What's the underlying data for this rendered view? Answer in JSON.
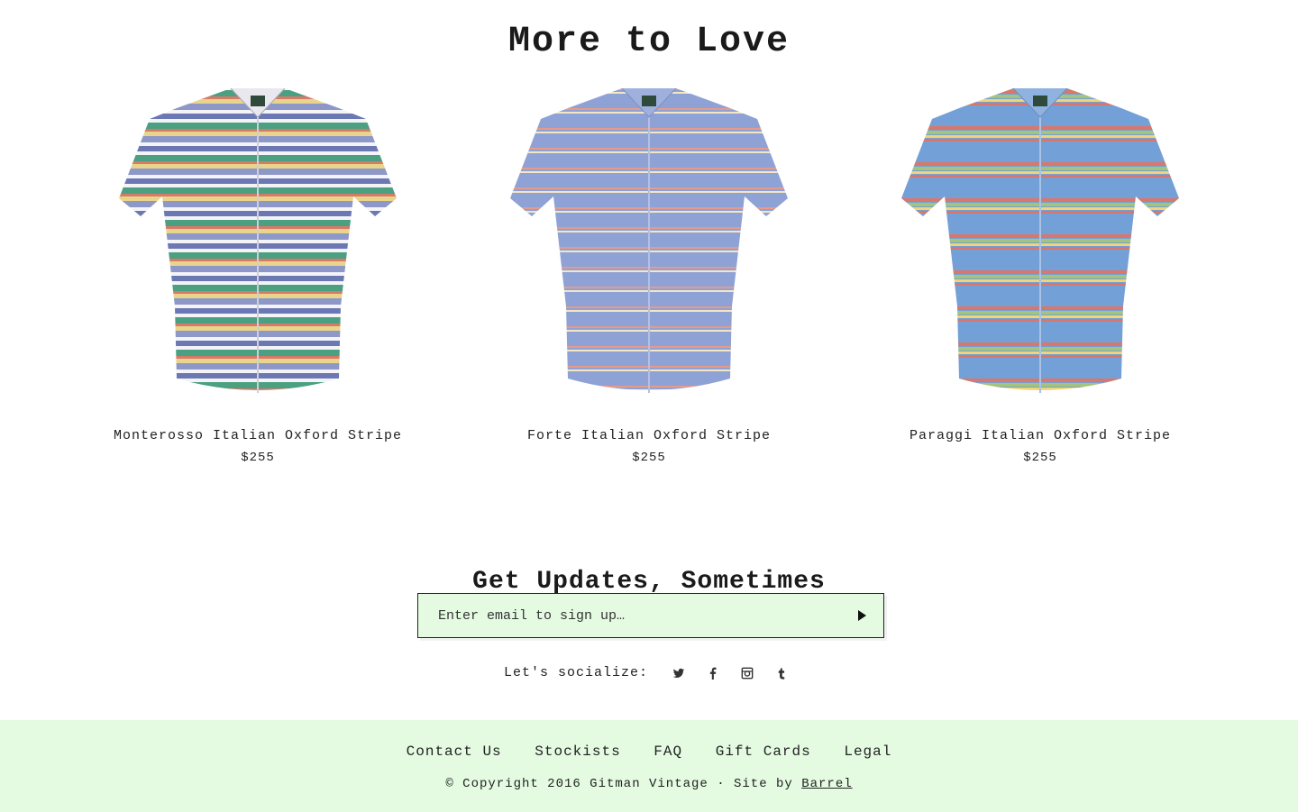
{
  "more_to_love": {
    "title": "More to Love",
    "products": [
      {
        "name": "Monterosso Italian Oxford Stripe",
        "price": "$255",
        "image": "short-sleeve-shirt-multicolor-stripe",
        "stripe_colors": [
          "#6c78b4",
          "#f4f4f6",
          "#4aa080",
          "#d97a68",
          "#e8d48a",
          "#8d97c8"
        ]
      },
      {
        "name": "Forte Italian Oxford Stripe",
        "price": "$255",
        "image": "short-sleeve-shirt-blue-stripe",
        "stripe_colors": [
          "#8fa2d6",
          "#e69a8a",
          "#f2e6c4",
          "#8fa2d6"
        ]
      },
      {
        "name": "Paraggi Italian Oxford Stripe",
        "price": "$255",
        "image": "short-sleeve-shirt-blue-multistripe",
        "stripe_colors": [
          "#73a0d6",
          "#d9776d",
          "#a4c47a",
          "#f0d37a",
          "#73a0d6"
        ]
      }
    ]
  },
  "updates": {
    "title": "Get Updates, Sometimes",
    "email_placeholder": "Enter email to sign up…",
    "submit_icon": "play-arrow-icon"
  },
  "social": {
    "label": "Let's socialize:",
    "icons": [
      "twitter-icon",
      "facebook-icon",
      "instagram-icon",
      "tumblr-icon"
    ]
  },
  "footer": {
    "nav": [
      "Contact Us",
      "Stockists",
      "FAQ",
      "Gift Cards",
      "Legal"
    ],
    "copyright": "© Copyright 2016 Gitman Vintage · Site by ",
    "credit_link": "Barrel",
    "background": "#e4fbe2"
  }
}
